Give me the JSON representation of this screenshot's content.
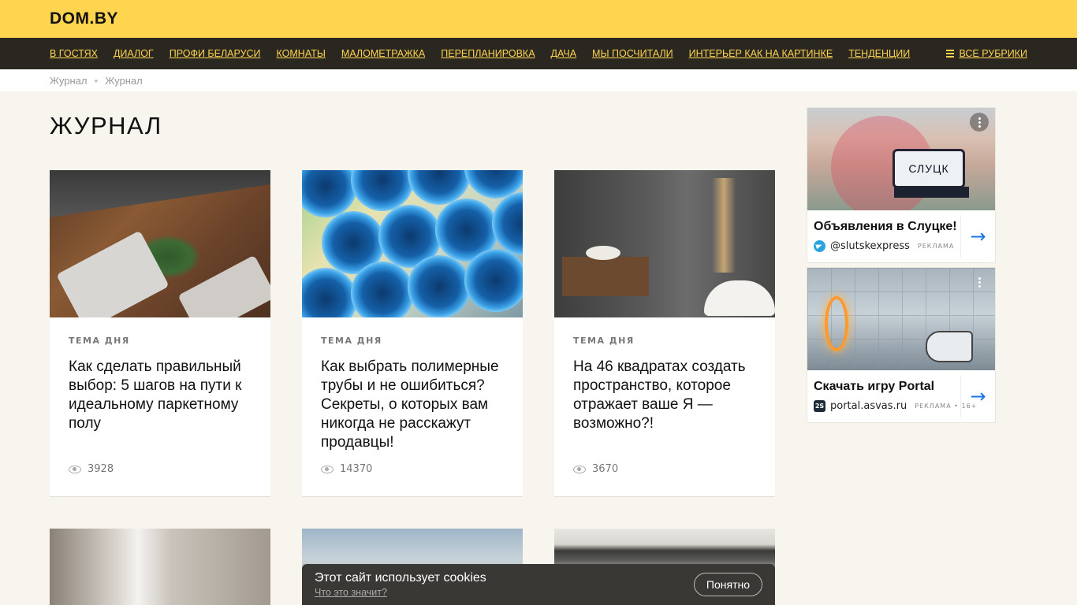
{
  "header": {
    "logo": "DOM.BY"
  },
  "nav": {
    "items": [
      "В ГОСТЯХ",
      "ДИАЛОГ",
      "ПРОФИ БЕЛАРУСИ",
      "КОМНАТЫ",
      "МАЛОМЕТРАЖКА",
      "ПЕРЕПЛАНИРОВКА",
      "ДАЧА",
      "МЫ ПОСЧИТАЛИ",
      "ИНТЕРЬЕР КАК НА КАРТИНКЕ",
      "ТЕНДЕНЦИИ"
    ],
    "all_rubrics": "ВСЕ РУБРИКИ"
  },
  "breadcrumb": [
    "Журнал",
    "Журнал"
  ],
  "page": {
    "title": "ЖУРНАЛ"
  },
  "cards": [
    {
      "tag": "ТЕМА ДНЯ",
      "title": "Как сделать правильный выбор: 5 шагов на пути к идеальному паркетному полу",
      "views": "3928"
    },
    {
      "tag": "ТЕМА ДНЯ",
      "title": "Как выбрать полимерные трубы и не ошибиться? Секреты, о которых вам никогда не расскажут продавцы!",
      "views": "14370"
    },
    {
      "tag": "ТЕМА ДНЯ",
      "title": "На 46 квадратах создать пространство, которое отражает ваше Я — возможно?!",
      "views": "3670"
    }
  ],
  "ads": [
    {
      "image_text": "СЛУЦК",
      "title": "Объявления в Слуцке!",
      "source": "@slutskexpress",
      "label": "РЕКЛАМА",
      "icon": "telegram-icon"
    },
    {
      "title": "Скачать игру Portal",
      "source": "portal.asvas.ru",
      "label": "РЕКЛАМА • 16+",
      "icon_text": "2S",
      "icon": "site-icon"
    }
  ],
  "cookie": {
    "message": "Этот сайт использует cookies",
    "link": "Что это значит?",
    "button": "Понятно"
  },
  "colors": {
    "header_bg": "#ffd54f",
    "nav_bg": "#2a2620",
    "nav_link": "#ffd54f",
    "page_bg": "#f8f5ee",
    "ad_arrow": "#1a73e8"
  }
}
